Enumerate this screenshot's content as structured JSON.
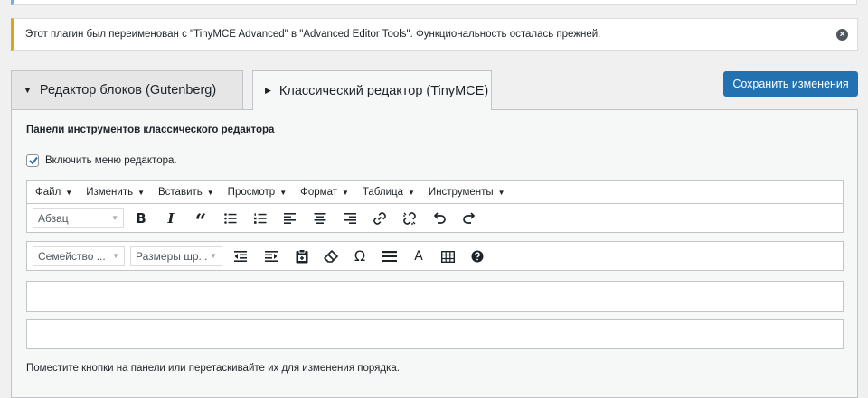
{
  "notice": {
    "text": "Этот плагин был переименован с \"TinyMCE Advanced\" в \"Advanced Editor Tools\". Функциональность осталась прежней.",
    "dismiss_icon": "x-circle-icon"
  },
  "tabs": [
    {
      "label": "Редактор блоков (Gutenberg)",
      "active": false
    },
    {
      "label": "Классический редактор (TinyMCE)",
      "active": true
    }
  ],
  "save_button": "Сохранить изменения",
  "panel": {
    "title": "Панели инструментов классического редактора",
    "enable_menu": {
      "label": "Включить меню редактора.",
      "checked": true
    },
    "menu": [
      "Файл",
      "Изменить",
      "Вставить",
      "Просмотр",
      "Формат",
      "Таблица",
      "Инструменты"
    ],
    "toolbar1": {
      "select": "Абзац",
      "buttons": [
        "bold-icon",
        "italic-icon",
        "blockquote-icon",
        "bullet-list-icon",
        "numbered-list-icon",
        "align-left-icon",
        "align-center-icon",
        "align-right-icon",
        "link-icon",
        "unlink-icon",
        "undo-icon",
        "redo-icon"
      ]
    },
    "toolbar2": {
      "select_font": "Семейство ...",
      "select_size": "Размеры шр...",
      "buttons": [
        "outdent-icon",
        "indent-icon",
        "paste-icon",
        "eraser-icon",
        "omega-icon",
        "horizontal-line-icon",
        "text-color-icon",
        "table-icon",
        "help-icon"
      ]
    },
    "footer": "Поместите кнопки на панели или перетаскивайте их для изменения порядка."
  },
  "colors": {
    "accent": "#2271b1",
    "notice_warning": "#dba617",
    "info": "#72aee6"
  }
}
